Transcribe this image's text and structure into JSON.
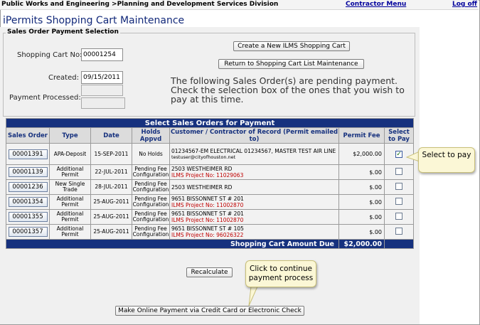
{
  "topbar": {
    "breadcrumb": "Public Works and Engineering >Planning and Development Services Division",
    "contractor_menu": "Contractor Menu",
    "logoff": "Log off"
  },
  "page": {
    "title": "iPermits Shopping Cart Maintenance",
    "legend": "Sales Order Payment Selection"
  },
  "form": {
    "cart_no_label": "Shopping Cart No:",
    "cart_no_value": "00001254",
    "created_label": "Created:",
    "created_value": "09/15/2011",
    "payment_label": "Payment Processed:",
    "payment_value": "",
    "create_btn": "Create a New ILMS Shopping Cart",
    "return_btn": "Return to Shopping Cart List Maintenance",
    "info_text": "The following Sales Order(s) are pending payment. Check the selection box of the ones that you wish to pay at this time."
  },
  "table": {
    "title": "Select Sales Orders for Payment",
    "headers": {
      "sales_order": "Sales Order",
      "type": "Type",
      "date": "Date",
      "holds": "Holds Appvd",
      "customer": "Customer / Contractor of Record (Permit emailed to)",
      "fee": "Permit Fee",
      "select": "Select to Pay"
    },
    "rows": [
      {
        "order": "00001391",
        "type": "APA-Deposit",
        "date": "15-SEP-2011",
        "holds": "No Holds",
        "customer": "01234567-EM ELECTRICAL 01234567, MASTER TEST AIR LINE",
        "email": "testuser@cityofhouston.net",
        "project": "",
        "fee": "$2,000.00",
        "checked": true
      },
      {
        "order": "00001139",
        "type": "Additional Permit",
        "date": "22-JUL-2011",
        "holds": "Pending Fee Configuration",
        "customer": "2503 WESTHEIMER RD",
        "email": "",
        "project": "ILMS Project No: 11029063",
        "fee": "$.00",
        "checked": false
      },
      {
        "order": "00001236",
        "type": "New Single Trade",
        "date": "28-JUL-2011",
        "holds": "Pending Fee Configuration",
        "customer": "2503 WESTHEIMER RD",
        "email": "",
        "project": "",
        "fee": "$.00",
        "checked": false
      },
      {
        "order": "00001354",
        "type": "Additional Permit",
        "date": "25-AUG-2011",
        "holds": "Pending Fee Configuration",
        "customer": "9651 BISSONNET ST # 201",
        "email": "",
        "project": "ILMS Project No: 11002870",
        "fee": "$.00",
        "checked": false
      },
      {
        "order": "00001355",
        "type": "Additional Permit",
        "date": "25-AUG-2011",
        "holds": "Pending Fee Configuration",
        "customer": "9651 BISSONNET ST # 201",
        "email": "",
        "project": "ILMS Project No: 11002870",
        "fee": "$.00",
        "checked": false
      },
      {
        "order": "00001357",
        "type": "Additional Permit",
        "date": "25-AUG-2011",
        "holds": "Pending Fee Configuration",
        "customer": "9651 BISSONNET ST # 105",
        "email": "",
        "project": "ILMS Project No: 96026322",
        "fee": "$.00",
        "checked": false
      }
    ],
    "total_label": "Shopping Cart Amount Due",
    "total_value": "$2,000.00"
  },
  "actions": {
    "recalculate": "Recalculate",
    "pay": "Make Online Payment via Credit Card or Electronic Check"
  },
  "callouts": {
    "select": "Select to pay",
    "continue": "Click to continue payment process"
  },
  "colors": {
    "header_blue": "#16317e",
    "project_red": "#c00000"
  }
}
